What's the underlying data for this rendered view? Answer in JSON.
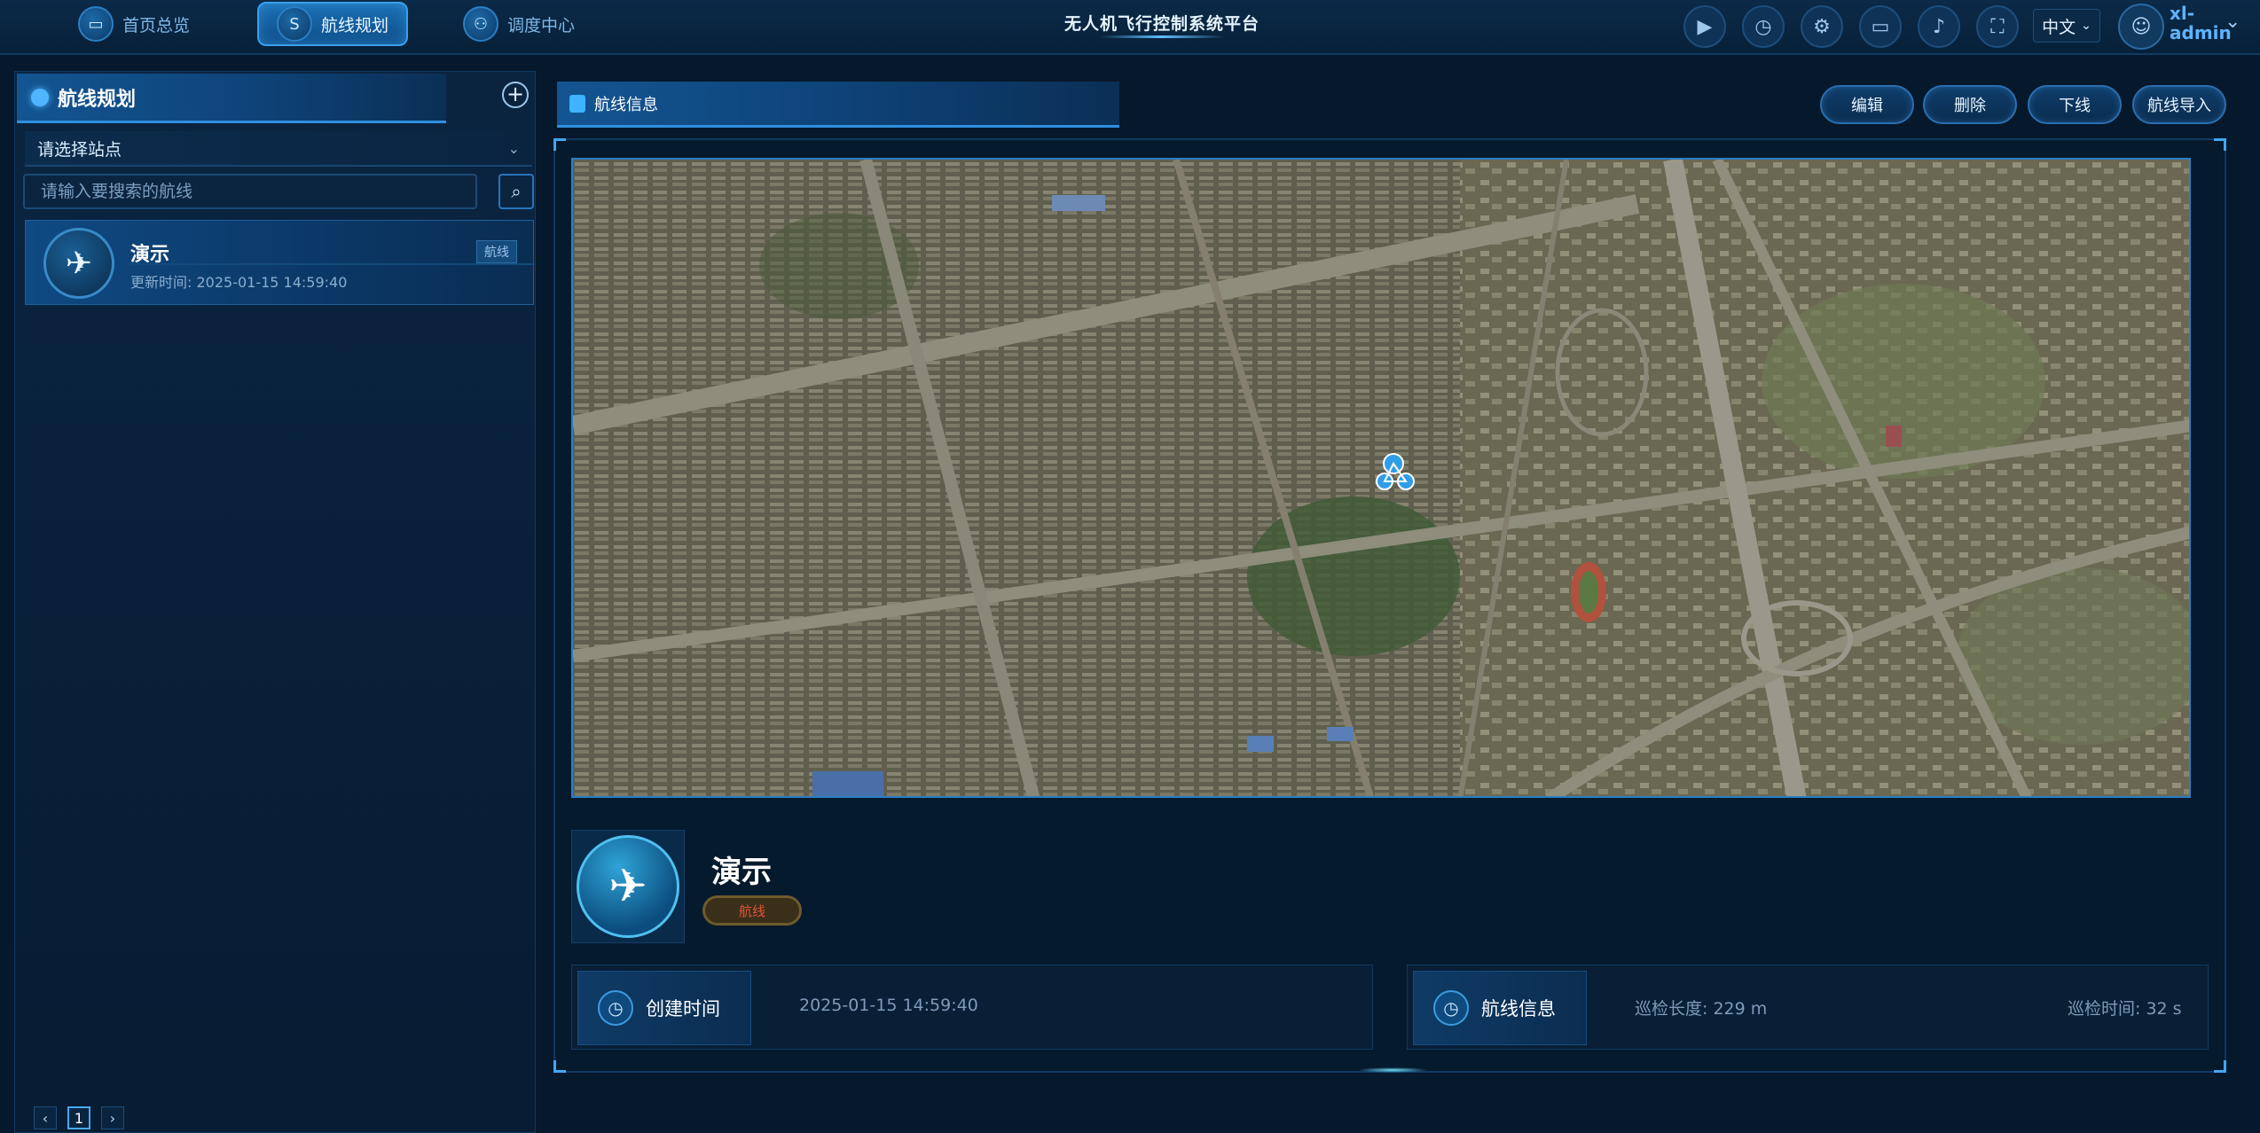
{
  "top_nav": {
    "tabs": [
      {
        "label": "首页总览",
        "icon": "monitor-icon"
      },
      {
        "label": "航线规划",
        "icon": "route-icon"
      },
      {
        "label": "调度中心",
        "icon": "dispatch-icon"
      }
    ],
    "app_title": "无人机飞行控制系统平台",
    "tools": [
      "video-icon",
      "clock-icon",
      "settings-icon",
      "screen-icon",
      "bell-icon",
      "fullscreen-icon"
    ],
    "language": "中文",
    "username": "xl-admin"
  },
  "left_panel": {
    "title": "航线规划",
    "station_select": {
      "placeholder": "请选择站点"
    },
    "search": {
      "placeholder": "请输入要搜索的航线"
    },
    "routes": [
      {
        "name": "演示",
        "updated": "更新时间: 2025-01-15 14:59:40",
        "badge": "航线"
      }
    ],
    "pagination": {
      "current": "1"
    }
  },
  "main_panel": {
    "tab_title": "航线信息",
    "actions": [
      "编辑",
      "删除",
      "下线",
      "航线导入"
    ],
    "route": {
      "name": "演示",
      "badge": "航线"
    },
    "created": {
      "label": "创建时间",
      "value": "2025-01-15 14:59:40"
    },
    "route_info": {
      "label": "航线信息",
      "length": "巡检长度: 229 m",
      "duration": "巡检时间: 32 s"
    }
  },
  "colors": {
    "accent": "#2f8fdf",
    "bg": "#06182b",
    "badge_text": "#e0553a"
  }
}
